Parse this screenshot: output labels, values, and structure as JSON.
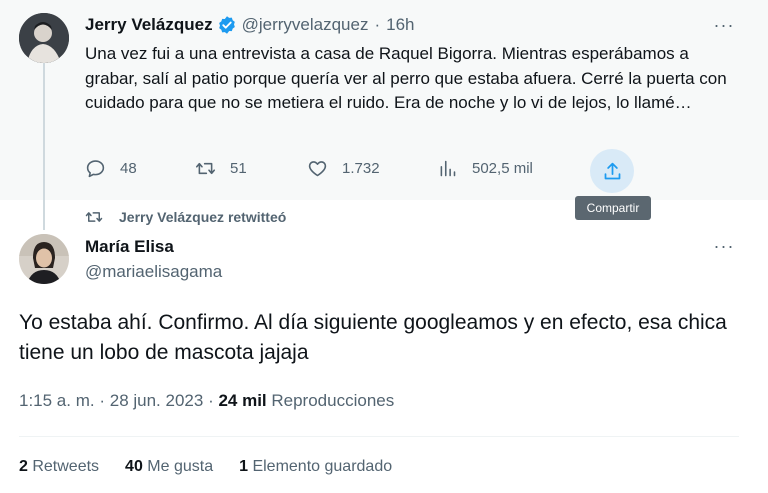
{
  "top_tweet": {
    "name": "Jerry Velázquez",
    "handle": "@jerryvelazquez",
    "separator": "·",
    "time": "16h",
    "more": "···",
    "text": "Una vez fui a una entrevista a casa de Raquel Bigorra. Mientras esperábamos a grabar, salí al patio porque quería ver al perro que estaba afuera. Cerré la puerta con cuidado para que no se metiera el ruido. Era de noche y lo vi de lejos, lo llamé…",
    "replies": "48",
    "retweets": "51",
    "likes": "1.732",
    "views": "502,5 mil",
    "share_tooltip": "Compartir",
    "icons": [
      "reply-icon",
      "retweet-icon",
      "heart-icon",
      "views-icon",
      "share-icon",
      "verified-icon"
    ]
  },
  "retweet_label": "Jerry Velázquez retwitteó",
  "main_tweet": {
    "name": "María Elisa",
    "handle": "@mariaelisagama",
    "more": "···",
    "text": "Yo estaba ahí. Confirmo. Al día siguiente googleamos y en efecto, esa chica tiene un lobo de mascota jajaja",
    "time": "1:15 a. m.",
    "date": "28 jun. 2023",
    "views_count": "24 mil",
    "views_label": "Reproducciones",
    "retweets_count": "2",
    "retweets_label": "Retweets",
    "likes_count": "40",
    "likes_label": "Me gusta",
    "bookmarks_count": "1",
    "bookmarks_label": "Elemento guardado"
  },
  "colors": {
    "accent": "#1d9bf0",
    "secondary_text": "#536471",
    "highlight_bg": "#f7f9f9"
  }
}
